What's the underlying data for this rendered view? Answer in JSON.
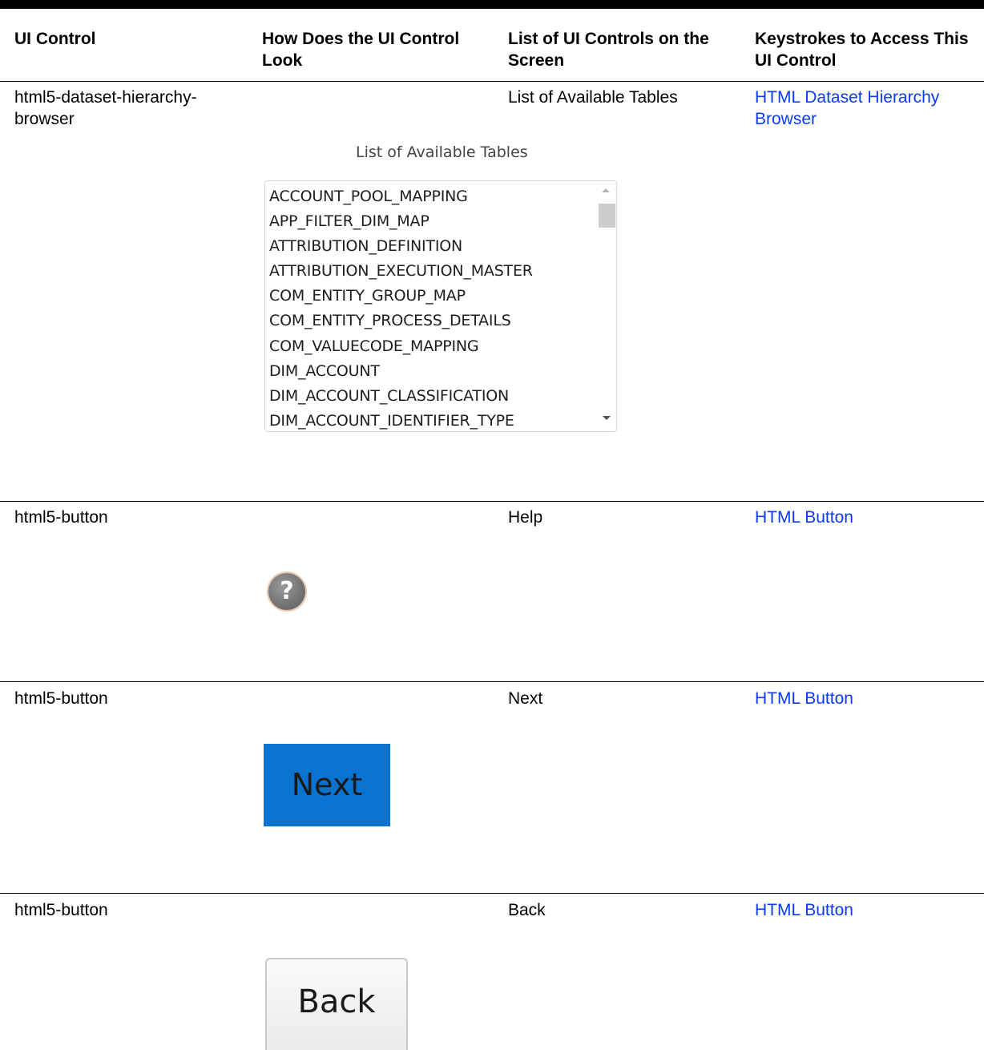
{
  "headers": {
    "ui_control": "UI Control",
    "look": "How Does the UI Control Look",
    "list": "List of UI Controls on the Screen",
    "keystrokes": "Keystrokes to Access This UI Control"
  },
  "rows": [
    {
      "ui_control": "html5-dataset-hierarchy-browser",
      "list": "List of Available Tables",
      "keystrokes": "HTML Dataset Hierarchy Browser",
      "look": {
        "caption": "List of Available Tables",
        "items": [
          "ACCOUNT_POOL_MAPPING",
          "APP_FILTER_DIM_MAP",
          "ATTRIBUTION_DEFINITION",
          "ATTRIBUTION_EXECUTION_MASTER",
          "COM_ENTITY_GROUP_MAP",
          "COM_ENTITY_PROCESS_DETAILS",
          "COM_VALUECODE_MAPPING",
          "DIM_ACCOUNT",
          "DIM_ACCOUNT_CLASSIFICATION",
          "DIM_ACCOUNT_IDENTIFIER_TYPE"
        ]
      }
    },
    {
      "ui_control": "html5-button",
      "list": "Help",
      "keystrokes": "HTML Button",
      "look": {
        "icon": "help-icon",
        "glyph": "?"
      }
    },
    {
      "ui_control": "html5-button",
      "list": "Next",
      "keystrokes": "HTML Button",
      "look": {
        "label": "Next",
        "color": "#0a72cf"
      }
    },
    {
      "ui_control": "html5-button",
      "list": "Back",
      "keystrokes": "HTML Button",
      "look": {
        "label": "Back"
      }
    }
  ]
}
